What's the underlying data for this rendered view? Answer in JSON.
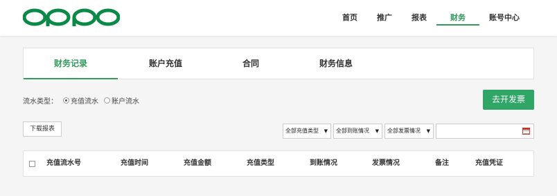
{
  "header": {
    "logo_text": "oppo",
    "brand_color": "#0a8a47",
    "nav": [
      {
        "label": "首页",
        "active": false
      },
      {
        "label": "推广",
        "active": false
      },
      {
        "label": "报表",
        "active": false
      },
      {
        "label": "财务",
        "active": true
      },
      {
        "label": "账号中心",
        "active": false
      }
    ]
  },
  "tabs": [
    {
      "label": "财务记录",
      "active": true
    },
    {
      "label": "账户充值",
      "active": false
    },
    {
      "label": "合同",
      "active": false
    },
    {
      "label": "财务信息",
      "active": false
    }
  ],
  "filter": {
    "flow_type_label": "流水类型：",
    "options": [
      {
        "label": "充值流水",
        "checked": true
      },
      {
        "label": "账户流水",
        "checked": false
      }
    ]
  },
  "invoice_button": "去开发票",
  "download_button": "下载报表",
  "selects": [
    {
      "value": "全部充值类型"
    },
    {
      "value": "全部到账情况"
    },
    {
      "value": "全部发票情况"
    }
  ],
  "date_input": {
    "value": ""
  },
  "table": {
    "columns": [
      "充值流水号",
      "充值时间",
      "充值金额",
      "充值类型",
      "到账情况",
      "发票情况",
      "备注",
      "充值凭证"
    ]
  },
  "colors": {
    "accent": "#31995a",
    "button": "#2fa566"
  }
}
